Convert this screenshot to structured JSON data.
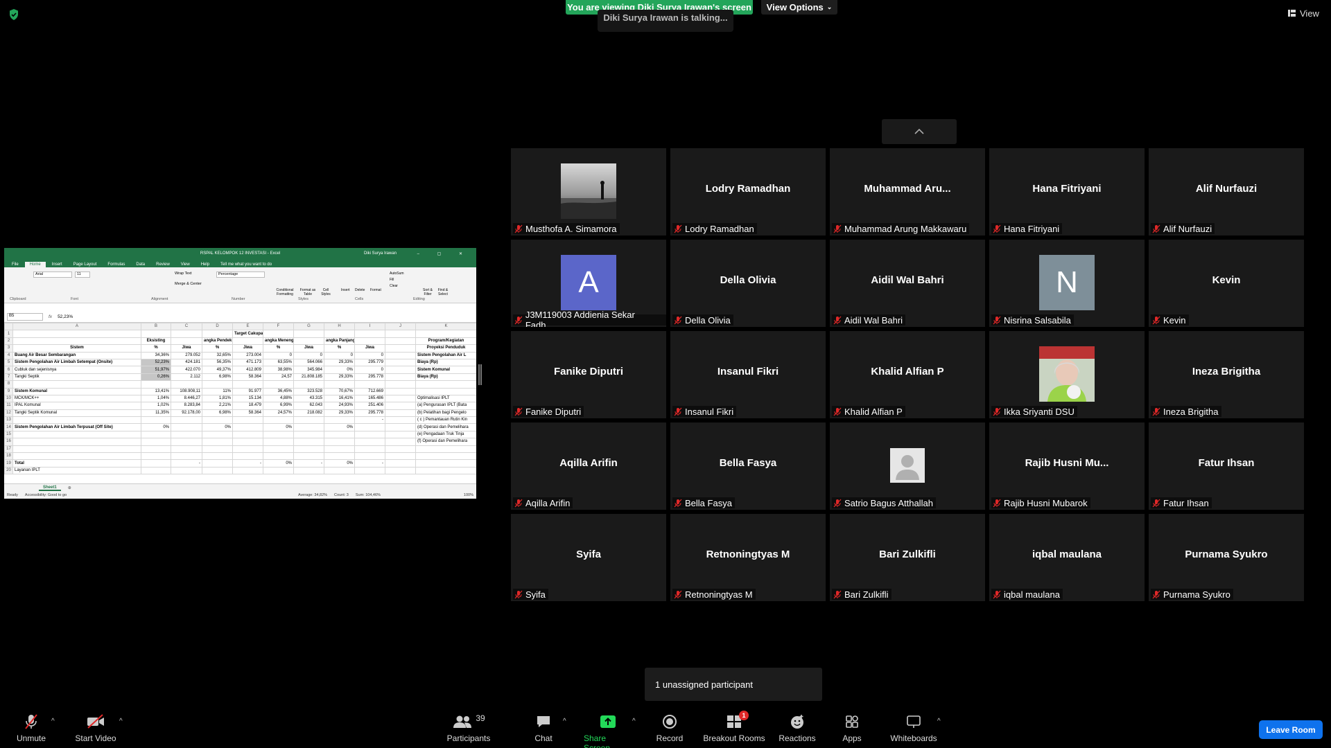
{
  "top": {
    "banner": "You are viewing Diki Surya Irawan's screen",
    "view_options": "View Options",
    "talking": "Diki Surya Irawan is talking...",
    "view": "View"
  },
  "excel": {
    "title": "RSPAL KELOMPOK 12 INVESTASI  -  Excel",
    "user": "Diki Surya Irawan",
    "tabs": [
      "File",
      "Home",
      "Insert",
      "Page Layout",
      "Formulas",
      "Data",
      "Review",
      "View",
      "Help"
    ],
    "tell_me": "Tell me what you want to do",
    "font_name": "Arial",
    "font_size": "11",
    "number_format": "Percentage",
    "wrap_text": "Wrap Text",
    "merge_center": "Merge & Center",
    "conditional_formatting": "Conditional Formatting",
    "format_as_table": "Format as Table",
    "cell_styles": "Cell Styles",
    "insert": "Insert",
    "delete": "Delete",
    "format": "Format",
    "autosum": "AutoSum",
    "fill": "Fill",
    "clear": "Clear",
    "sort_filter": "Sort & Filter",
    "find_select": "Find & Select",
    "groups": [
      "Clipboard",
      "Font",
      "Alignment",
      "Number",
      "Styles",
      "Cells",
      "Editing"
    ],
    "namebox": "B5",
    "formula": "52,23%",
    "columns": [
      "A",
      "B",
      "C",
      "D",
      "E",
      "F",
      "G",
      "H",
      "I",
      "J",
      "K"
    ],
    "rows": [
      [
        "1",
        "",
        "",
        "",
        "",
        "Target Cakupan Layanan %",
        "",
        "",
        "",
        "",
        "",
        ""
      ],
      [
        "2",
        "",
        "Eksisting",
        "",
        "angka Pendek (2017-2019",
        "",
        "angka Menengah (2020-20",
        "",
        "angka Panjang (2025-2030",
        "",
        "",
        "Program/Kegiatan"
      ],
      [
        "3",
        "Sistem",
        "%",
        "Jiwa",
        "%",
        "Jiwa",
        "%",
        "Jiwa",
        "%",
        "Jiwa",
        "",
        "Proyeksi Penduduk"
      ],
      [
        "4",
        "Buang Air Besar Sembarangan",
        "34,36%",
        "279.052",
        "32,65%",
        "273.004",
        "0",
        "0",
        "0",
        "0",
        "",
        "Sistem Pengolahan Air L"
      ],
      [
        "5",
        "Sistem Pengolahan Air Limbah Setempat (Onsite)",
        "52,23%",
        "424.181",
        "56,35%",
        "471.173",
        "63,55%",
        "564.066",
        "29,33%",
        "295.779",
        "",
        "Biaya (Rp)"
      ],
      [
        "6",
        "Cubluk dan sejenisnya",
        "51,97%",
        "422.070",
        "49,37%",
        "412.809",
        "38,98%",
        "345.984",
        "0%",
        "0",
        "",
        "Sistem Komunal"
      ],
      [
        "7",
        "Tangki Septik",
        "0,26%",
        "2.112",
        "6,98%",
        "58.364",
        "24,57",
        "21.808.185",
        "29,33%",
        "295.778",
        "",
        "Biaya (Rp)"
      ],
      [
        "8",
        "",
        "",
        "",
        "",
        "",
        "",
        "",
        "",
        "",
        "",
        ""
      ],
      [
        "9",
        "Sistem Komunal",
        "13,41%",
        "108.908,11",
        "11%",
        "91.977",
        "36,45%",
        "323.528",
        "70,67%",
        "712.669",
        "",
        ""
      ],
      [
        "10",
        "MCK/MCK++",
        "1,04%",
        "8.446,27",
        "1,81%",
        "15.134",
        "4,88%",
        "43.315",
        "16,41%",
        "165.486",
        "",
        "Optimalisasi IPLT"
      ],
      [
        "11",
        "IPAL Komunal",
        "1,02%",
        "8.283,84",
        "2,21%",
        "18.479",
        "6,99%",
        "62.043",
        "24,93%",
        "251.406",
        "",
        "(a) Pengurasan IPLT (Bata"
      ],
      [
        "12",
        "Tangki Septik Komunal",
        "11,35%",
        "92.178,00",
        "6,98%",
        "58.364",
        "24,57%",
        "218.082",
        "29,33%",
        "295.778",
        "",
        "(b) Pelatihan bagi Pengelo"
      ],
      [
        "13",
        "",
        "",
        "",
        "",
        "",
        "",
        "",
        "",
        "-",
        "",
        "( c ) Pemantauan Rutin Kin"
      ],
      [
        "14",
        "Sistem Pengolahan Air Limbah Terpusat (Off Site)",
        "0%",
        "",
        "0%",
        "",
        "0%",
        "",
        "0%",
        "",
        "",
        "(d) Operasi dan Pemelihara"
      ],
      [
        "15",
        "",
        "",
        "",
        "",
        "",
        "",
        "",
        "",
        "",
        "",
        "(e) Pengadaan Truk Tinja"
      ],
      [
        "16",
        "",
        "",
        "",
        "",
        "",
        "",
        "",
        "",
        "",
        "",
        "(f) Operasi dan Pemelihara"
      ],
      [
        "17",
        "",
        "",
        "",
        "",
        "",
        "",
        "",
        "",
        "",
        "",
        ""
      ],
      [
        "18",
        "",
        "",
        "",
        "",
        "",
        "",
        "",
        "",
        "",
        "",
        ""
      ],
      [
        "19",
        "Total",
        "",
        "-",
        "",
        "-",
        "0%",
        "-",
        "0%",
        "-",
        "",
        ""
      ],
      [
        "20",
        "Layanan IPLT",
        "",
        "",
        "",
        "",
        "",
        "",
        "",
        "",
        "",
        ""
      ]
    ],
    "sheet": "Sheet1",
    "status_ready": "Ready",
    "status_access": "Accessibility: Good to go",
    "status_avg": "Average: 34,82%",
    "status_count": "Count: 3",
    "status_sum": "Sum: 104,46%",
    "zoom": "100%"
  },
  "tiles": [
    {
      "name": "",
      "label": "Musthofa A. Simamora",
      "avatar": "photo-beach"
    },
    {
      "name": "Lodry Ramadhan",
      "label": "Lodry Ramadhan"
    },
    {
      "name": "Muhammad  Aru...",
      "label": "Muhammad Arung Makkawaru"
    },
    {
      "name": "Hana Fitriyani",
      "label": "Hana Fitriyani"
    },
    {
      "name": "Alif Nurfauzi",
      "label": "Alif Nurfauzi"
    },
    {
      "name": "",
      "label": "J3M119003 Addienia Sekar Fadh...",
      "avatar": "letter",
      "letter": "A",
      "color": "#5b66c9"
    },
    {
      "name": "Della Olivia",
      "label": "Della Olivia"
    },
    {
      "name": "Aidil Wal Bahri",
      "label": "Aidil Wal Bahri"
    },
    {
      "name": "",
      "label": "Nisrina Salsabila",
      "avatar": "letter",
      "letter": "N",
      "color": "#7e8f99"
    },
    {
      "name": "Kevin",
      "label": "Kevin"
    },
    {
      "name": "Fanike Diputri",
      "label": "Fanike Diputri"
    },
    {
      "name": "Insanul Fikri",
      "label": "Insanul Fikri"
    },
    {
      "name": "Khalid Alfian P",
      "label": "Khalid Alfian P"
    },
    {
      "name": "",
      "label": "Ikka Sriyanti DSU",
      "avatar": "photo-person"
    },
    {
      "name": "Ineza Brigitha",
      "label": "Ineza Brigitha"
    },
    {
      "name": "Aqilla Arifin",
      "label": "Aqilla Arifin"
    },
    {
      "name": "Bella Fasya",
      "label": "Bella Fasya"
    },
    {
      "name": "",
      "label": "Satrio Bagus Atthallah",
      "avatar": "default"
    },
    {
      "name": "Rajib  Husni  Mu...",
      "label": "Rajib Husni Mubarok"
    },
    {
      "name": "Fatur Ihsan",
      "label": "Fatur Ihsan"
    },
    {
      "name": "Syifa",
      "label": "Syifa"
    },
    {
      "name": "Retnoningtyas M",
      "label": "Retnoningtyas M"
    },
    {
      "name": "Bari Zulkifli",
      "label": "Bari Zulkifli"
    },
    {
      "name": "iqbal maulana",
      "label": "iqbal maulana"
    },
    {
      "name": "Purnama Syukro",
      "label": "Purnama Syukro"
    }
  ],
  "popup": "1 unassigned participant",
  "toolbar": {
    "unmute": "Unmute",
    "start_video": "Start Video",
    "participants": "Participants",
    "participants_count": "39",
    "chat": "Chat",
    "share_screen": "Share Screen",
    "record": "Record",
    "breakout_rooms": "Breakout Rooms",
    "breakout_badge": "1",
    "reactions": "Reactions",
    "apps": "Apps",
    "whiteboards": "Whiteboards",
    "leave": "Leave Room"
  },
  "colors": {
    "banner": "#23a55a",
    "share_screen": "#23d959",
    "leave": "#0e72ed",
    "muted_icon": "#e02828",
    "excel_green": "#217346",
    "tile_bg": "#1a1a1a"
  }
}
